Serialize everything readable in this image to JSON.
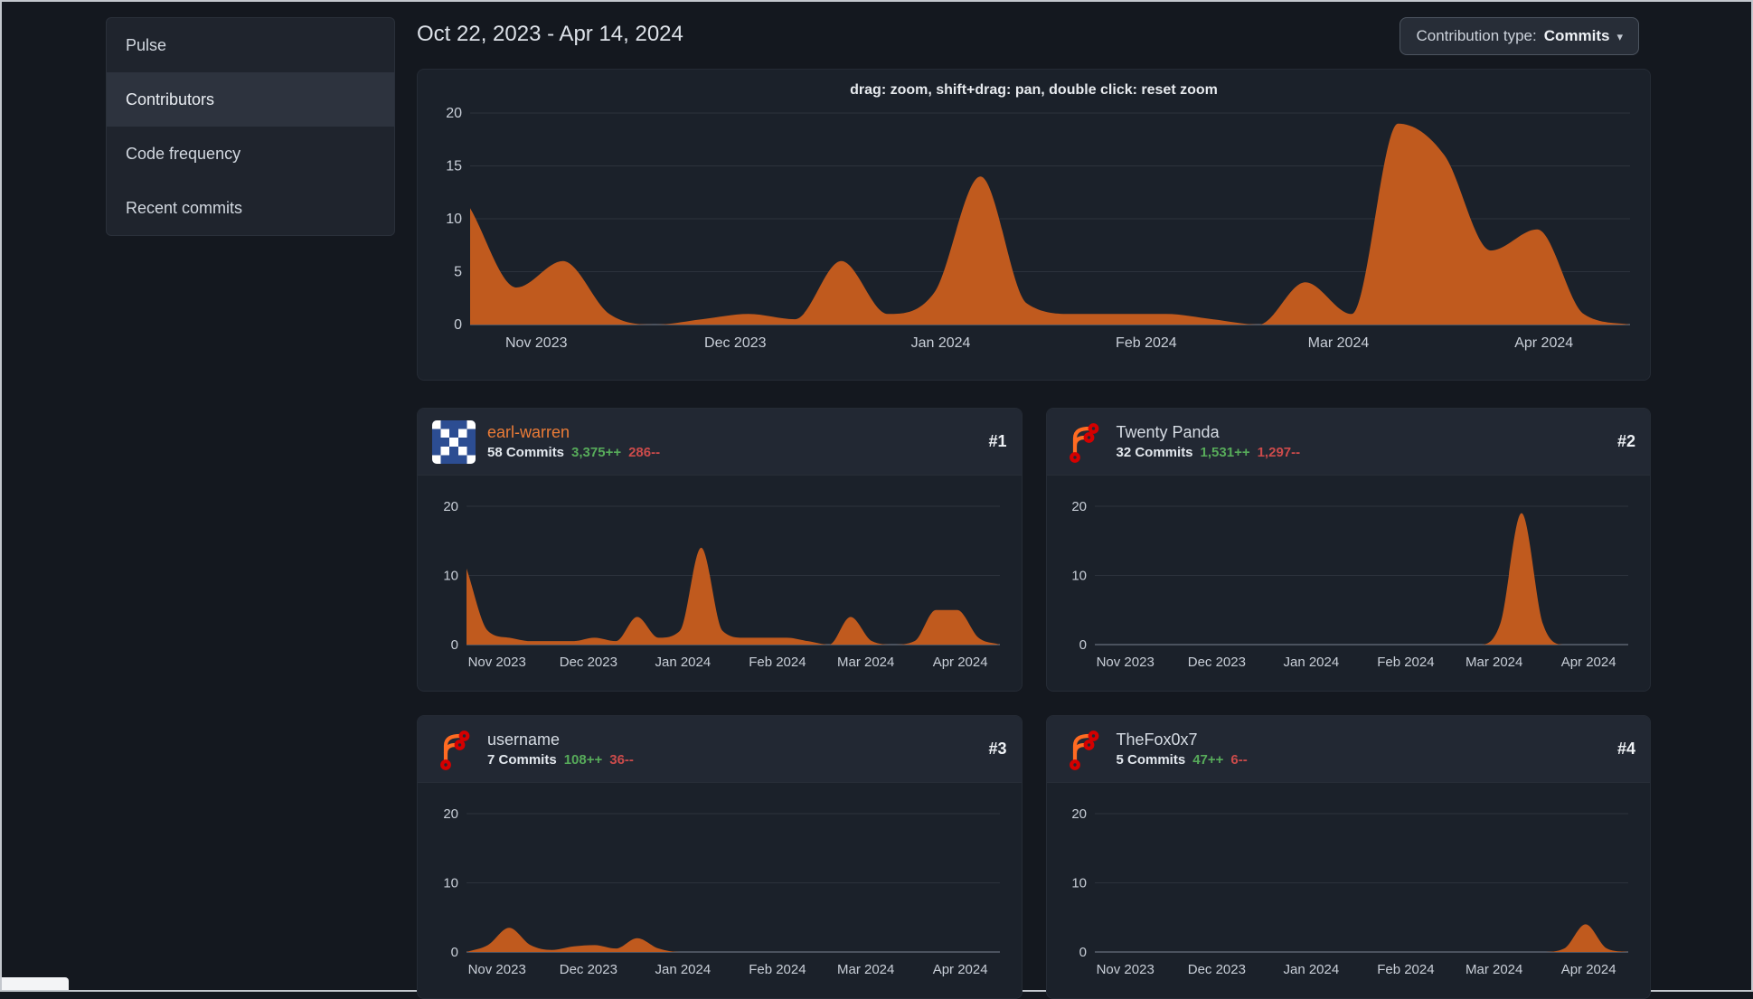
{
  "sidebar": {
    "items": [
      {
        "label": "Pulse",
        "active": false
      },
      {
        "label": "Contributors",
        "active": true
      },
      {
        "label": "Code frequency",
        "active": false
      },
      {
        "label": "Recent commits",
        "active": false
      }
    ]
  },
  "header": {
    "date_range": "Oct 22, 2023 - Apr 14, 2024",
    "contribution_type_label": "Contribution type:",
    "contribution_type_value": "Commits",
    "dropdown_caret_icon": "chevron-down"
  },
  "colors": {
    "chart_fill": "#c05a1e",
    "link_orange": "#ec7c37",
    "additions_green": "#57ab5a",
    "deletions_red": "#cc4b4b",
    "grid_line": "#2c323c",
    "axis_line": "#7b8391",
    "axis_text": "#c9cfd8"
  },
  "x_axis": {
    "unit": "week",
    "tick_fracs": [
      0.0571,
      0.2286,
      0.4057,
      0.5829,
      0.7486,
      0.9257
    ],
    "tick_labels": [
      "Nov 2023",
      "Dec 2023",
      "Jan 2024",
      "Feb 2024",
      "Mar 2024",
      "Apr 2024"
    ]
  },
  "main_chart": {
    "type": "area",
    "hint": "drag: zoom, shift+drag: pan, double click: reset zoom",
    "y_ticks": [
      0,
      5,
      10,
      15,
      20
    ],
    "y_max": 20,
    "values": [
      11,
      3.5,
      6,
      1,
      0,
      0.5,
      1,
      0.5,
      6,
      1,
      3,
      14,
      2,
      1,
      1,
      1,
      0.5,
      0,
      4,
      1,
      19,
      16,
      7,
      9,
      1,
      0
    ]
  },
  "contributors": [
    {
      "rank": "#1",
      "name": "earl-warren",
      "linked": true,
      "avatar": "identicon-blue",
      "commits": "58 Commits",
      "additions": "3,375++",
      "deletions": "286--",
      "chart": {
        "type": "area",
        "y_ticks": [
          0,
          10,
          20
        ],
        "y_max": 20,
        "values": [
          11,
          2,
          1,
          0.5,
          0.5,
          0.5,
          1,
          0.5,
          4,
          1,
          2,
          14,
          2,
          1,
          1,
          1,
          0.5,
          0,
          4,
          0.5,
          0,
          0.5,
          5,
          5,
          1,
          0
        ]
      }
    },
    {
      "rank": "#2",
      "name": "Twenty Panda",
      "linked": false,
      "avatar": "forgejo-logo",
      "commits": "32 Commits",
      "additions": "1,531++",
      "deletions": "1,297--",
      "chart": {
        "type": "area",
        "y_ticks": [
          0,
          10,
          20
        ],
        "y_max": 20,
        "values": [
          0,
          0,
          0,
          0,
          0,
          0,
          0,
          0,
          0,
          0,
          0,
          0,
          0,
          0,
          0,
          0,
          0,
          0,
          0,
          3,
          19,
          3,
          0,
          0,
          0,
          0
        ]
      }
    },
    {
      "rank": "#3",
      "name": "username",
      "linked": false,
      "avatar": "forgejo-logo",
      "commits": "7 Commits",
      "additions": "108++",
      "deletions": "36--",
      "chart": {
        "type": "area",
        "y_ticks": [
          0,
          10,
          20
        ],
        "y_max": 20,
        "values": [
          0,
          1,
          3.5,
          1,
          0.3,
          0.8,
          1,
          0.5,
          2,
          0.5,
          0,
          0,
          0,
          0,
          0,
          0,
          0,
          0,
          0,
          0,
          0,
          0,
          0,
          0,
          0,
          0
        ]
      }
    },
    {
      "rank": "#4",
      "name": "TheFox0x7",
      "linked": false,
      "avatar": "forgejo-logo",
      "commits": "5 Commits",
      "additions": "47++",
      "deletions": "6--",
      "chart": {
        "type": "area",
        "y_ticks": [
          0,
          10,
          20
        ],
        "y_max": 20,
        "values": [
          0,
          0,
          0,
          0,
          0,
          0,
          0,
          0,
          0,
          0,
          0,
          0,
          0,
          0,
          0,
          0,
          0,
          0,
          0,
          0,
          0,
          0,
          0.5,
          4,
          0.5,
          0
        ]
      }
    }
  ]
}
